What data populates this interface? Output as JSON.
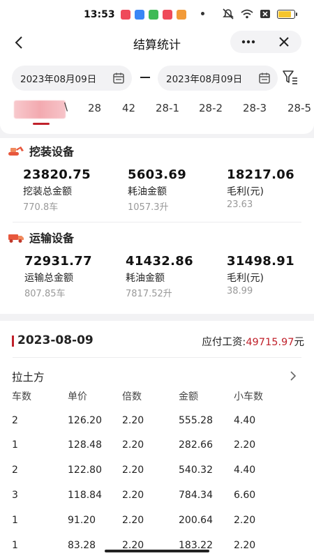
{
  "status_bar": {
    "time": "13:53"
  },
  "header": {
    "title": "结算统计",
    "more_label": "•••"
  },
  "filter": {
    "start_date": "2023年08月09日",
    "end_date": "2023年08月09日"
  },
  "tabs": [
    {
      "label": "28"
    },
    {
      "label": "42"
    },
    {
      "label": "28-1"
    },
    {
      "label": "28-2"
    },
    {
      "label": "28-3"
    },
    {
      "label": "28-5"
    }
  ],
  "excavation": {
    "title": "挖装设备",
    "stats": [
      {
        "value": "23820.75",
        "label": "挖装总金额",
        "sub": "770.8车"
      },
      {
        "value": "5603.69",
        "label": "耗油金额",
        "sub": "1057.3升"
      },
      {
        "value": "18217.06",
        "label": "毛利(元)",
        "sub": "23.63"
      }
    ]
  },
  "transport": {
    "title": "运输设备",
    "stats": [
      {
        "value": "72931.77",
        "label": "运输总金额",
        "sub": "807.85车"
      },
      {
        "value": "41432.86",
        "label": "耗油金额",
        "sub": "7817.52升"
      },
      {
        "value": "31498.91",
        "label": "毛利(元)",
        "sub": "38.99"
      }
    ]
  },
  "detail": {
    "date": "2023-08-09",
    "pay_label": "应付工资:",
    "pay_amount": "49715.97",
    "pay_unit": "元",
    "group_title": "拉土方",
    "columns": [
      "车数",
      "单价",
      "倍数",
      "金额",
      "小车数"
    ],
    "rows": [
      [
        "2",
        "126.20",
        "2.20",
        "555.28",
        "4.40"
      ],
      [
        "1",
        "128.48",
        "2.20",
        "282.66",
        "2.20"
      ],
      [
        "2",
        "122.80",
        "2.20",
        "540.32",
        "4.40"
      ],
      [
        "3",
        "118.84",
        "2.20",
        "784.34",
        "6.60"
      ],
      [
        "1",
        "91.20",
        "2.20",
        "200.64",
        "2.20"
      ],
      [
        "1",
        "83.28",
        "2.20",
        "183.22",
        "2.20"
      ]
    ]
  },
  "colors": {
    "accent": "#c0212b",
    "muted": "#999999",
    "background": "#f2f2f4"
  }
}
